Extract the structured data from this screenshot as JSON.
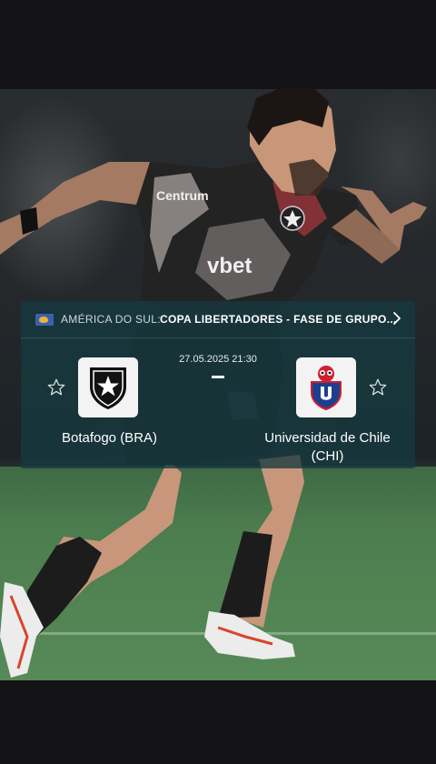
{
  "match": {
    "region": "AMÉRICA DO SUL:",
    "competition": "COPA LIBERTADORES - FASE DE GRUPO...",
    "datetime": "27.05.2025 21:30",
    "home_team": {
      "name": "Botafogo (BRA)",
      "crest_icon": "botafogo-crest-icon"
    },
    "away_team": {
      "name_line1": "Universidad de Chile",
      "name_line2": "(CHI)",
      "crest_icon": "universidad-de-chile-crest-icon"
    }
  },
  "photo": {
    "jersey_text_1": "Centrum",
    "jersey_text_2": "vbet"
  },
  "colors": {
    "card_background": "#163a40",
    "background": "#141416",
    "pitch": "#4e7d4f"
  }
}
